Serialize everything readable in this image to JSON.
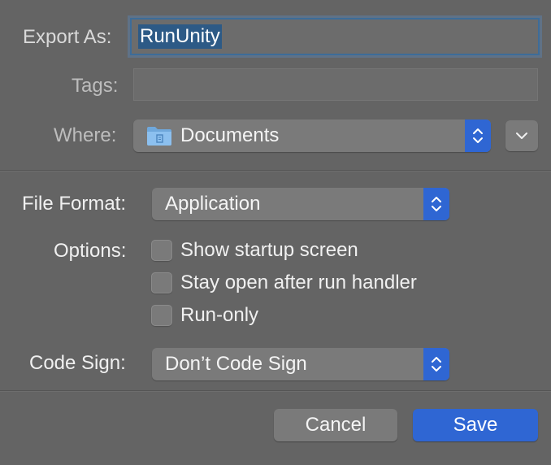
{
  "export_as": {
    "label": "Export As:",
    "value": "RunUnity"
  },
  "tags": {
    "label": "Tags:",
    "value": ""
  },
  "where": {
    "label": "Where:",
    "value": "Documents",
    "icon": "folder-icon"
  },
  "file_format": {
    "label": "File Format:",
    "value": "Application"
  },
  "options": {
    "label": "Options:",
    "items": [
      {
        "label": "Show startup screen",
        "checked": false
      },
      {
        "label": "Stay open after run handler",
        "checked": false
      },
      {
        "label": "Run-only",
        "checked": false
      }
    ]
  },
  "code_sign": {
    "label": "Code Sign:",
    "value": "Don’t Code Sign"
  },
  "buttons": {
    "cancel": "Cancel",
    "save": "Save"
  },
  "colors": {
    "accent": "#2f66d3",
    "background": "#646464",
    "control": "#7a7a7a"
  }
}
